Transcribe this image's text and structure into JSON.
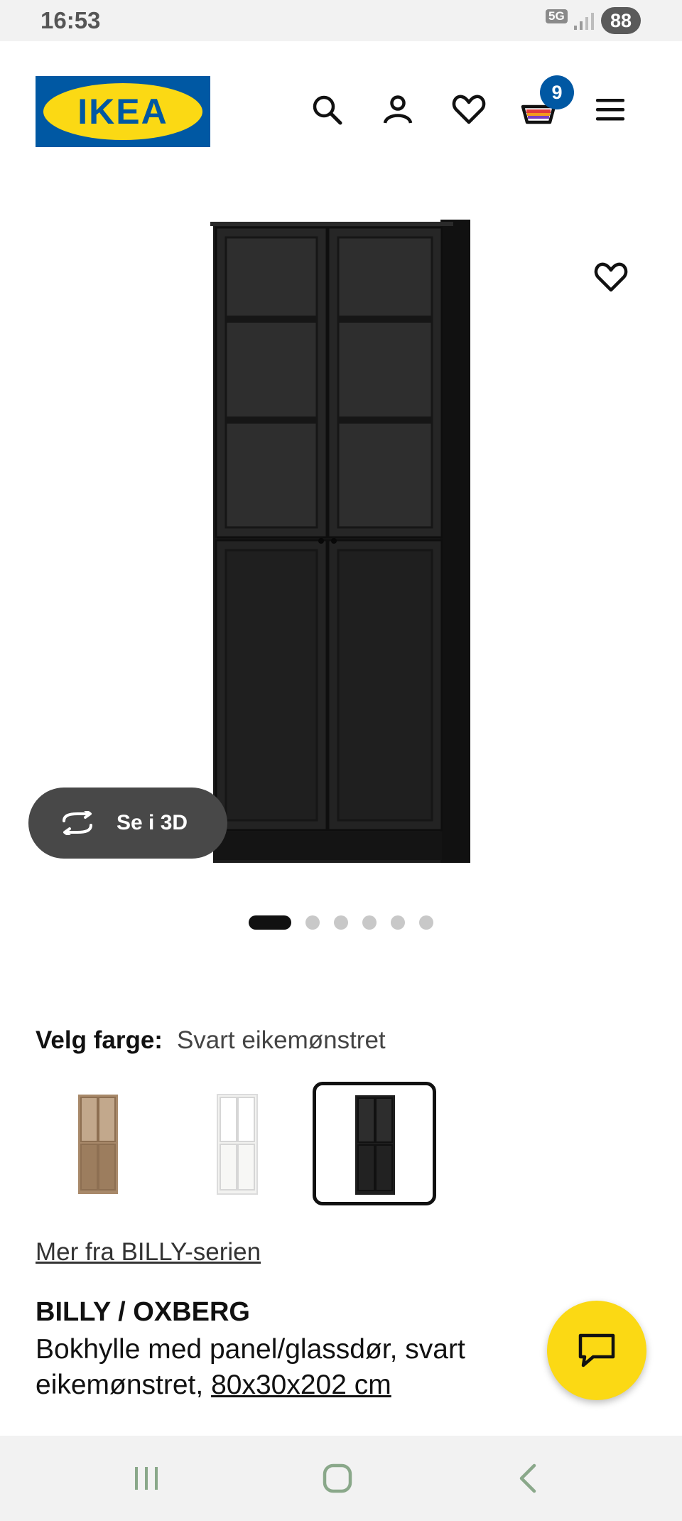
{
  "status_bar": {
    "time": "16:53",
    "network": "5G",
    "battery": "88"
  },
  "header": {
    "logo_text": "IKEA",
    "icons": [
      "search-icon",
      "user-icon",
      "heart-icon",
      "cart-icon",
      "menu-icon"
    ],
    "cart_count": "9"
  },
  "gallery": {
    "btn_3d_label": "Se i 3D",
    "slide_count": 6,
    "active_slide": 1
  },
  "color": {
    "label": "Velg farge:",
    "value": "Svart eikemønstret",
    "options": [
      "oak",
      "white",
      "black"
    ],
    "selected": 3
  },
  "series_link": "Mer fra BILLY-serien",
  "product": {
    "name": "BILLY / OXBERG",
    "desc_line": "Bokhylle med panel/glassdør, svart eikemønstret,",
    "size": "80x30x202 cm"
  },
  "colors": {
    "ikea_blue": "#0058a3",
    "ikea_yellow": "#fbd914",
    "badge": "#0058a3"
  }
}
